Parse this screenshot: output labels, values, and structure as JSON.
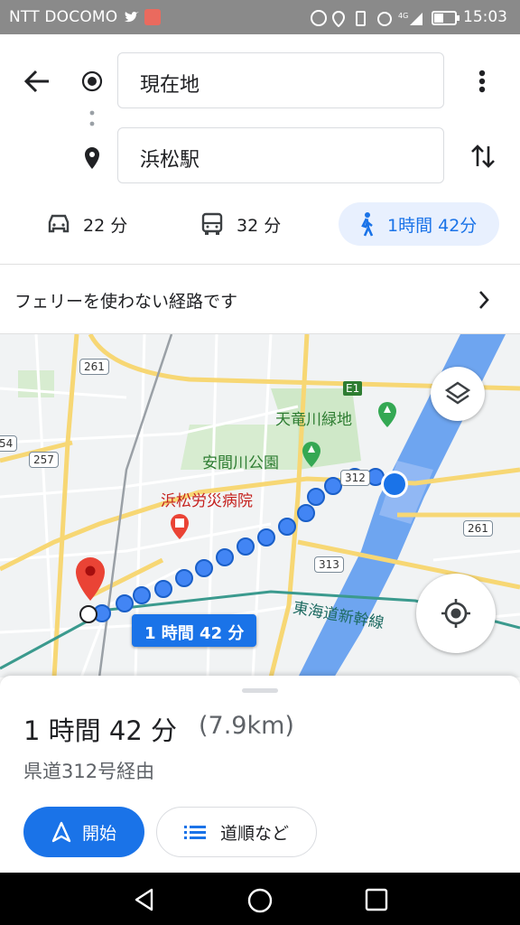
{
  "status_bar": {
    "carrier": "NTT DOCOMO",
    "time": "15:03"
  },
  "origin": {
    "value": "現在地"
  },
  "destination": {
    "value": "浜松駅"
  },
  "modes": [
    {
      "icon": "car-icon",
      "label": "22 分"
    },
    {
      "icon": "bus-icon",
      "label": "32 分"
    },
    {
      "icon": "walk-icon",
      "label": "1時間 42分"
    }
  ],
  "notice": {
    "text": "フェリーを使わない経路です"
  },
  "map": {
    "labels": {
      "tenryu_park": "天竜川緑地",
      "azuma_park": "安間川公園",
      "hospital": "浜松労災病院",
      "shinkansen": "東海道新幹線"
    },
    "shields": {
      "r261a": "261",
      "r257": "257",
      "r54": "54",
      "r312": "312",
      "r313": "313",
      "r261b": "261",
      "e1": "E1"
    },
    "route_badge": "1 時間 42 分"
  },
  "route": {
    "duration": "1 時間 42 分",
    "distance": "(7.9km)",
    "via": "県道312号経由",
    "start_label": "開始",
    "steps_label": "道順など"
  },
  "colors": {
    "accent": "#1a73e8",
    "active_chip_bg": "#e8f0fe",
    "pin": "#ea4335"
  }
}
